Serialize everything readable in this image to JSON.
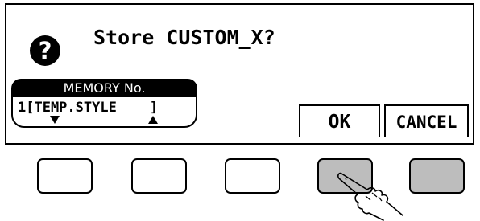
{
  "dialog": {
    "prompt": "Store CUSTOM_X?",
    "icon": "question-icon"
  },
  "memory": {
    "label": "MEMORY No.",
    "value": "1[TEMP.STYLE    ]"
  },
  "softkeys": {
    "ok_label": "OK",
    "cancel_label": "CANCEL"
  },
  "hardware_buttons": [
    {
      "name": "button-1",
      "lit": false
    },
    {
      "name": "button-2",
      "lit": false
    },
    {
      "name": "button-3",
      "lit": false
    },
    {
      "name": "button-4",
      "lit": true,
      "pressed": true
    },
    {
      "name": "button-5",
      "lit": true
    }
  ],
  "colors": {
    "lit_button": "#bdbdbd",
    "display_fg": "#000000",
    "display_bg": "#ffffff"
  }
}
